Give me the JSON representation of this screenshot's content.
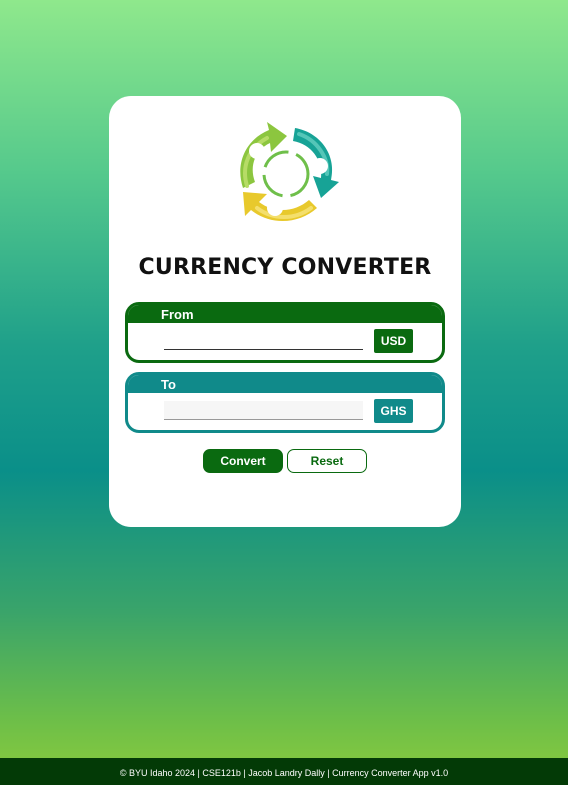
{
  "app": {
    "title": "CURRENCY CONVERTER",
    "logo_icon": "recycle-arrows-logo-icon"
  },
  "from": {
    "label": "From",
    "value": "",
    "currency": "USD",
    "color": "#0a6a10"
  },
  "to": {
    "label": "To",
    "value": "",
    "currency": "GHS",
    "color": "#108a8a"
  },
  "actions": {
    "convert_label": "Convert",
    "reset_label": "Reset"
  },
  "footer": {
    "text": "© BYU Idaho 2024 | CSE121b | Jacob Landry Dally | Currency Converter App v1.0"
  }
}
